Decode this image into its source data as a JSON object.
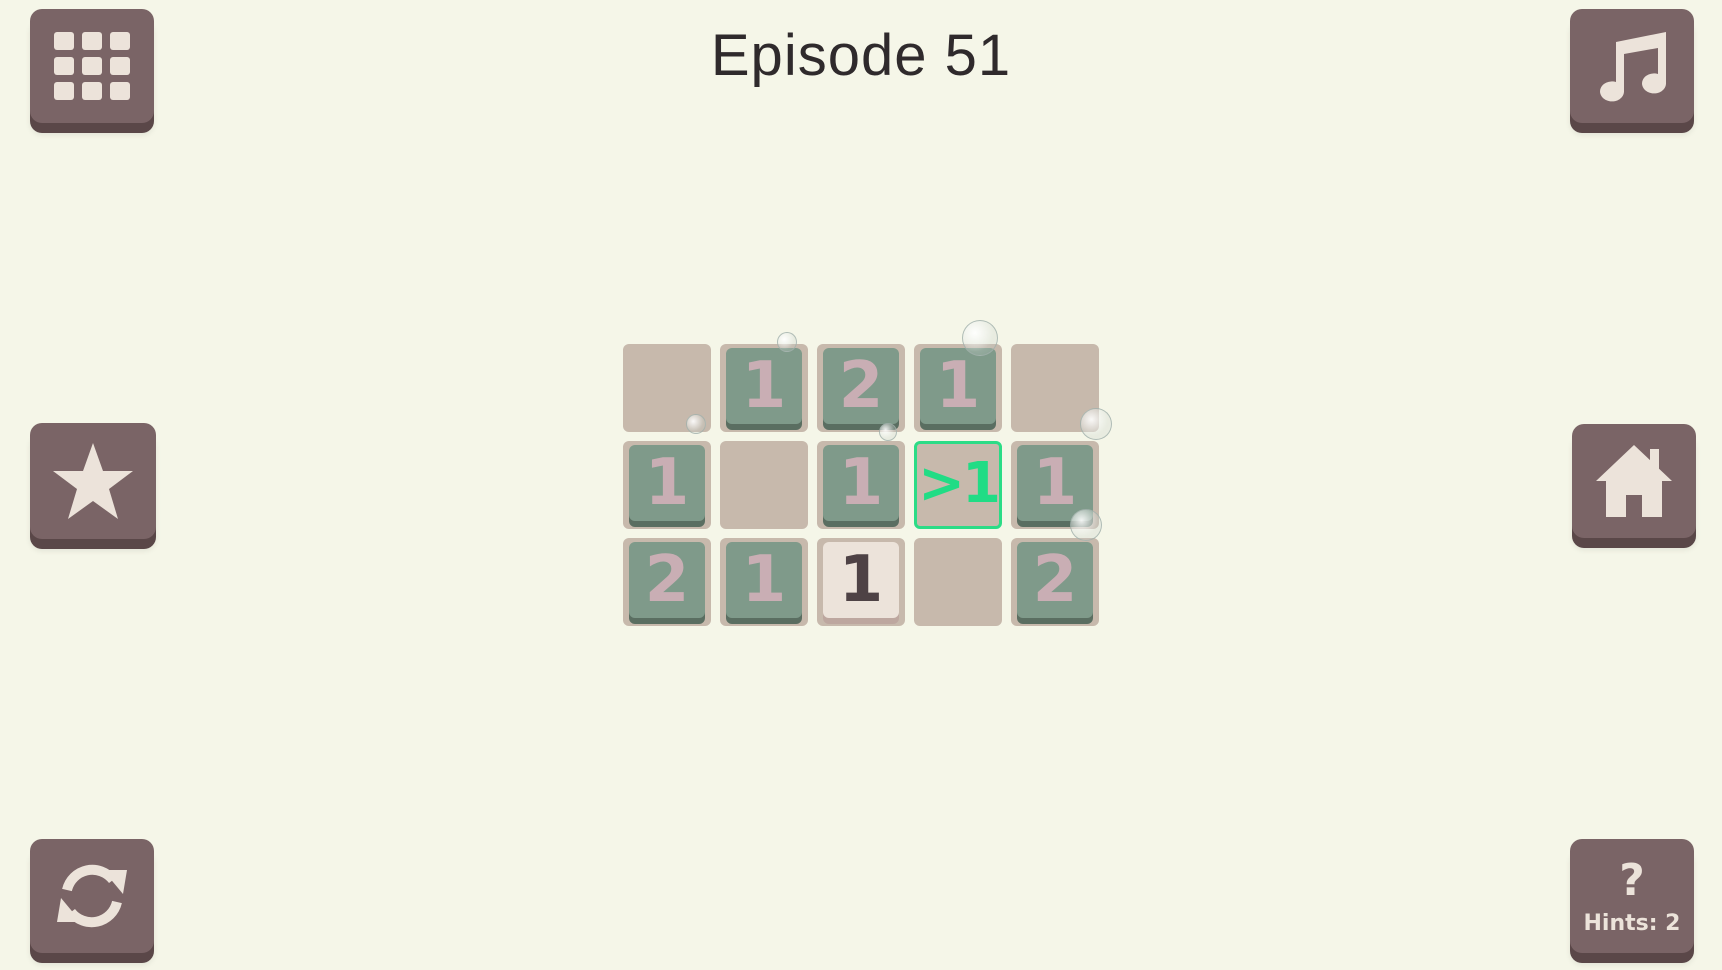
{
  "title": "Episode 51",
  "buttons": {
    "levels_icon": "grid-icon",
    "music_icon": "music-note-icon",
    "favorite_icon": "star-icon",
    "home_icon": "home-icon",
    "restart_icon": "restart-icon",
    "hint_symbol": "?",
    "hint_label": "Hints: 2"
  },
  "board": {
    "rows": 3,
    "cols": 5,
    "cells": [
      [
        {
          "state": "empty",
          "label": ""
        },
        {
          "state": "covered",
          "label": "1"
        },
        {
          "state": "covered",
          "label": "2"
        },
        {
          "state": "covered",
          "label": "1"
        },
        {
          "state": "empty",
          "label": ""
        }
      ],
      [
        {
          "state": "covered",
          "label": "1"
        },
        {
          "state": "empty",
          "label": ""
        },
        {
          "state": "covered",
          "label": "1"
        },
        {
          "state": "selected",
          "label": ">1"
        },
        {
          "state": "covered",
          "label": "1"
        }
      ],
      [
        {
          "state": "covered",
          "label": "2"
        },
        {
          "state": "covered",
          "label": "1"
        },
        {
          "state": "revealed",
          "label": "1"
        },
        {
          "state": "empty",
          "label": ""
        },
        {
          "state": "covered",
          "label": "2"
        }
      ]
    ]
  },
  "colors": {
    "background": "#f5f6e8",
    "button": "#7a6466",
    "tile": "#7f9a8a",
    "tile_text": "#c9aeb4",
    "selected": "#21dc85",
    "revealed_tile": "#ece3da"
  }
}
